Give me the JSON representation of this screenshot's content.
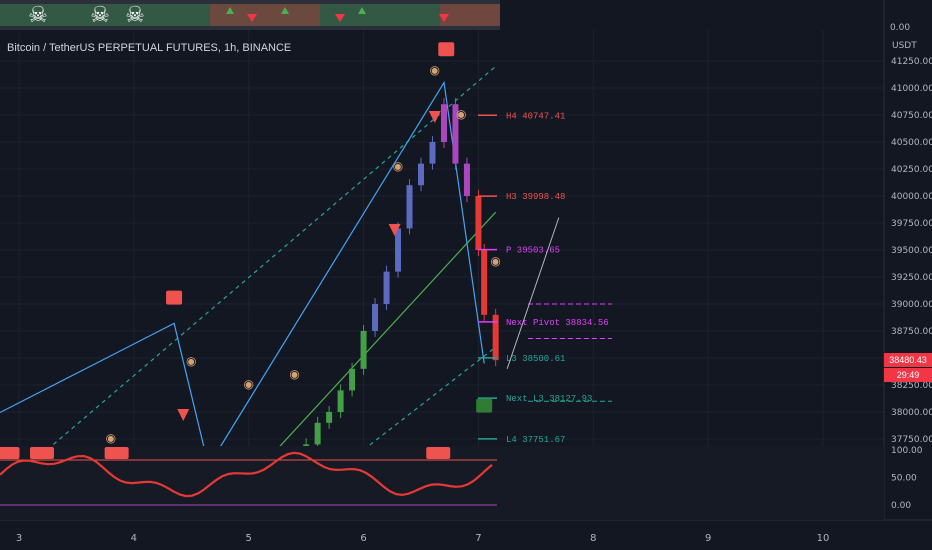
{
  "title": "Bitcoin / TetherUS PERPETUAL FUTURES, 1h, BINANCE",
  "currency": "USDT",
  "top_strip_value": "0.00",
  "current_price": "38480.43",
  "countdown": "29:49",
  "colors": {
    "bg": "#131722",
    "grid": "#1e222d",
    "up": "#26a69a",
    "down": "#ef5350",
    "accent_red": "#f23645",
    "pivot": "#e040fb"
  },
  "chart_data": {
    "type": "line",
    "main_panel": {
      "y_ticks": [
        41250,
        41000,
        40750,
        40500,
        40250,
        40000,
        39750,
        39500,
        39250,
        39000,
        38750,
        38500,
        38250,
        38000,
        37750
      ],
      "x_ticks": [
        "3",
        "4",
        "5",
        "6",
        "7",
        "8",
        "9",
        "10"
      ],
      "levels": [
        {
          "label": "H4 40747.41",
          "value": 40747.41,
          "color": "#ef5350"
        },
        {
          "label": "H3 39998.48",
          "value": 39998.48,
          "color": "#ef5350"
        },
        {
          "label": "P 39503.65",
          "value": 39503.65,
          "color": "#e040fb"
        },
        {
          "label": "Next Pivot 38834.56",
          "value": 38834.56,
          "color": "#e040fb"
        },
        {
          "label": "L3 38500.61",
          "value": 38500.61,
          "color": "#26a69a"
        },
        {
          "label": "Next L3 38127.93",
          "value": 38127.93,
          "color": "#26a69a"
        },
        {
          "label": "L4 37751.67",
          "value": 37751.67,
          "color": "#26a69a"
        }
      ],
      "zigzag": [
        {
          "x": 2.2,
          "y": 37650
        },
        {
          "x": 4.35,
          "y": 38820
        },
        {
          "x": 4.65,
          "y": 37500
        },
        {
          "x": 6.7,
          "y": 41050
        },
        {
          "x": 7.05,
          "y": 38450
        }
      ],
      "price_path": [
        {
          "x": 5.4,
          "y": 37500
        },
        {
          "x": 5.5,
          "y": 37700
        },
        {
          "x": 5.6,
          "y": 37900
        },
        {
          "x": 5.7,
          "y": 38000
        },
        {
          "x": 5.8,
          "y": 38200
        },
        {
          "x": 5.9,
          "y": 38400
        },
        {
          "x": 6.0,
          "y": 38750
        },
        {
          "x": 6.1,
          "y": 39000
        },
        {
          "x": 6.2,
          "y": 39300
        },
        {
          "x": 6.3,
          "y": 39700
        },
        {
          "x": 6.4,
          "y": 40100
        },
        {
          "x": 6.5,
          "y": 40300
        },
        {
          "x": 6.6,
          "y": 40500
        },
        {
          "x": 6.7,
          "y": 40850
        },
        {
          "x": 6.8,
          "y": 40300
        },
        {
          "x": 6.9,
          "y": 40000
        },
        {
          "x": 7.0,
          "y": 39500
        },
        {
          "x": 7.05,
          "y": 38900
        },
        {
          "x": 7.15,
          "y": 38480
        }
      ],
      "markers": [
        {
          "type": "HH",
          "x": 4.35,
          "y": 39050
        },
        {
          "type": "HH",
          "x": 6.72,
          "y": 41350
        },
        {
          "type": "HL",
          "x": 7.05,
          "y": 38050
        }
      ]
    },
    "oscillator": {
      "y_ticks": [
        100,
        50,
        0
      ],
      "bear_labels": [
        2.9,
        3.2,
        3.85,
        6.65
      ]
    }
  }
}
